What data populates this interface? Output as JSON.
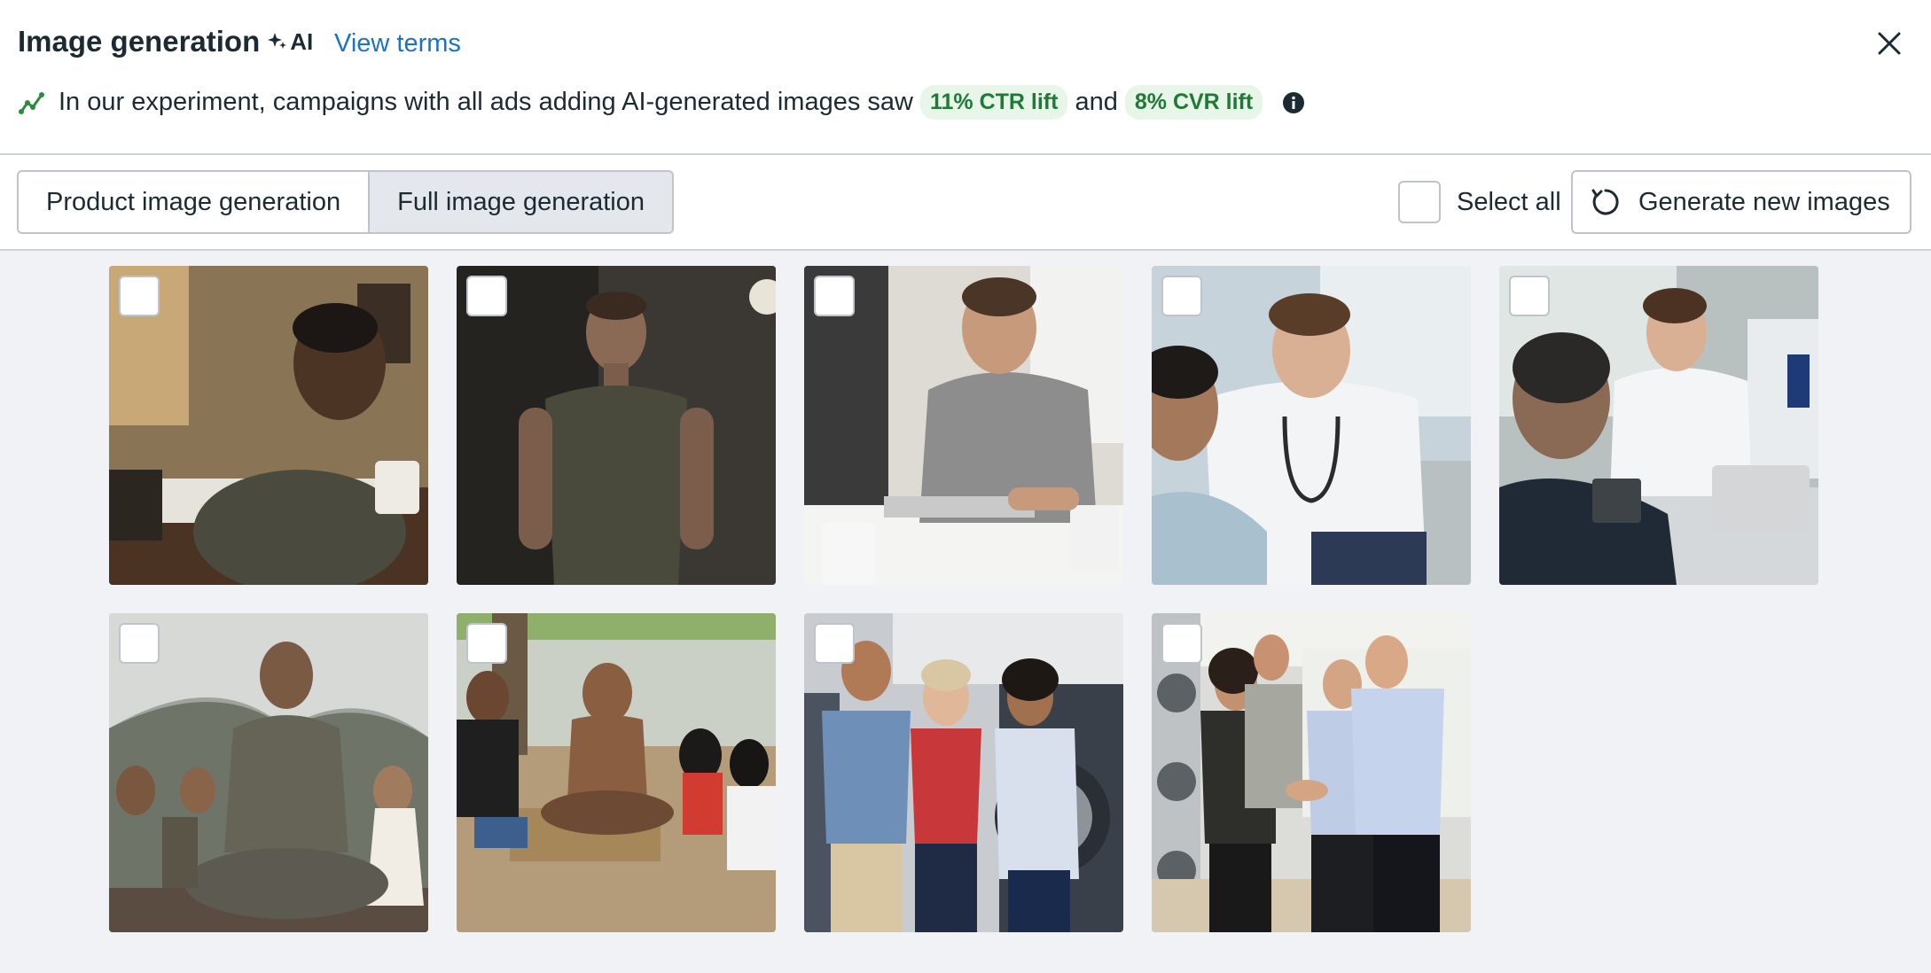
{
  "header": {
    "title": "Image generation",
    "ai_label": "AI",
    "view_terms": "View terms"
  },
  "banner": {
    "text_before": "In our experiment, campaigns with all ads adding AI-generated images saw",
    "ctr_lift": "11% CTR lift",
    "conjunction": "and",
    "cvr_lift": "8% CVR lift"
  },
  "tabs": [
    {
      "label": "Product image generation",
      "active": false
    },
    {
      "label": "Full image generation",
      "active": true
    }
  ],
  "toolbar": {
    "select_all_label": "Select all",
    "select_all_checked": false,
    "generate_label": "Generate new images"
  },
  "colors": {
    "accent_link": "#1d72c8",
    "lift_bg": "#e8f5e9",
    "lift_text": "#1e7a34",
    "gallery_bg": "#f0f2f5"
  },
  "images": [
    {
      "subject": "stressed man at desk",
      "checked": false
    },
    {
      "subject": "man in t-shirt in dark room",
      "checked": false
    },
    {
      "subject": "man working on laptop",
      "checked": false
    },
    {
      "subject": "doctor with patient",
      "checked": false
    },
    {
      "subject": "doctor consulting with tablet",
      "checked": false
    },
    {
      "subject": "meditation group outdoors",
      "checked": false
    },
    {
      "subject": "group sitting by a river",
      "checked": false
    },
    {
      "subject": "women in laundromat",
      "checked": false
    },
    {
      "subject": "people shaking hands in laundromat",
      "checked": false
    }
  ]
}
